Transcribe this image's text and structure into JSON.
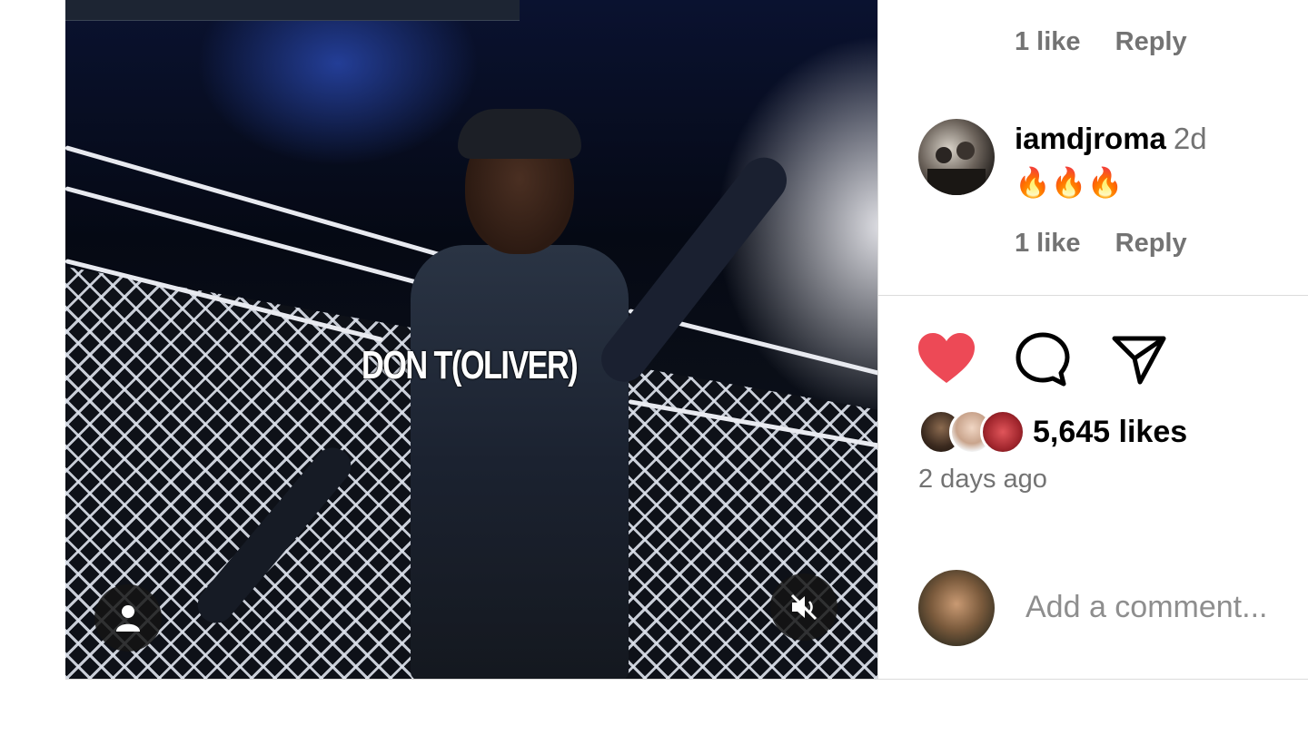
{
  "media": {
    "caption": "DON T(OLIVER)",
    "user_tag_icon": "person-icon",
    "mute_icon": "speaker-muted-icon"
  },
  "previous_comment": {
    "likes": "1 like",
    "reply": "Reply"
  },
  "comment": {
    "username": "iamdjroma",
    "time": "2d",
    "text": "🔥🔥🔥",
    "likes": "1 like",
    "reply": "Reply"
  },
  "actions": {
    "like_icon": "heart-filled-icon",
    "comment_icon": "comment-bubble-icon",
    "share_icon": "paper-plane-icon",
    "like_color": "#ed4956"
  },
  "likes_summary": {
    "count_text": "5,645 likes",
    "date": "2 days ago"
  },
  "comment_input": {
    "placeholder": "Add a comment..."
  }
}
